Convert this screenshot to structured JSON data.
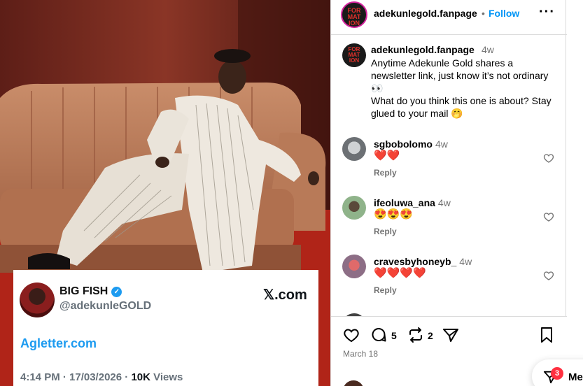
{
  "post": {
    "username": "adekunlegold.fanpage",
    "dot": "•",
    "follow_label": "Follow",
    "more_icon": "more-horizontal-icon",
    "avatar_text": [
      "FOR",
      "MAT",
      "ION"
    ],
    "caption": {
      "username": "adekunlegold.fanpage",
      "time": "4w",
      "text": "Anytime Adekunle Gold shares a newsletter link, just know it’s not ordinary 👀\nWhat do you think this one is about? Stay glued to your mail 🤭"
    },
    "comments": [
      {
        "username": "sgbobolomo",
        "time": "4w",
        "text": "❤️❤️",
        "reply": "Reply"
      },
      {
        "username": "ifeoluwa_ana",
        "time": "4w",
        "text": "😍😍😍",
        "reply": "Reply"
      },
      {
        "username": "cravesbyhoneyb_",
        "time": "4w",
        "text": "❤️❤️❤️❤️",
        "reply": "Reply"
      }
    ],
    "likes_icon": "heart-icon",
    "comment_count": "5",
    "repost_count": "2",
    "date": "March 18"
  },
  "tweet": {
    "name": "BIG FISH",
    "handle": "@adekunleGOLD",
    "source": "𝕏.com",
    "link": "Agletter.com",
    "time": "4:14 PM · 17/03/2026 · ",
    "views_count": "10K",
    "views_label": " Views"
  },
  "floating": {
    "badge": "3",
    "label": "Me"
  },
  "colors": {
    "accent": "#0095f6",
    "twitter_blue": "#1d9bf0",
    "divider": "#dbdbdb",
    "secondary_text": "#737373",
    "badge": "#ff3040"
  }
}
